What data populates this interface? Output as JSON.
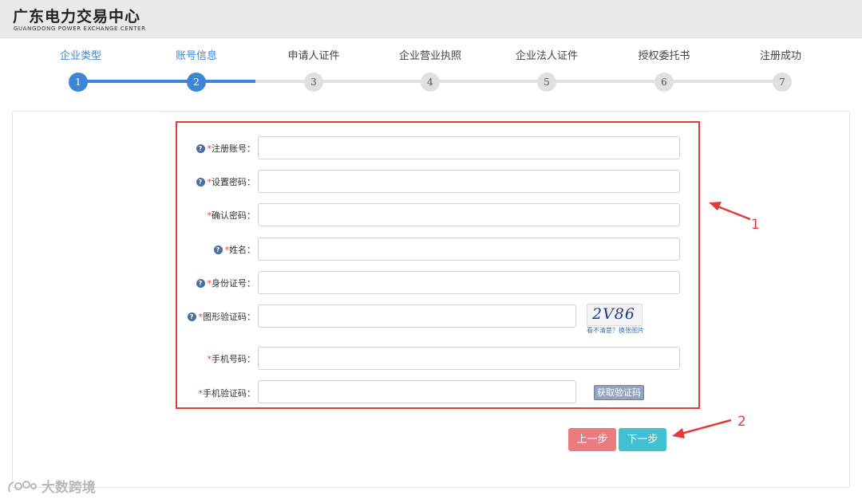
{
  "header": {
    "title": "广东电力交易中心",
    "subtitle": "GUANGDONG POWER EXCHANGE CENTER"
  },
  "steps": [
    {
      "label": "企业类型",
      "number": "1",
      "done": true
    },
    {
      "label": "账号信息",
      "number": "2",
      "done": true
    },
    {
      "label": "申请人证件",
      "number": "3",
      "done": false
    },
    {
      "label": "企业营业执照",
      "number": "4",
      "done": false
    },
    {
      "label": "企业法人证件",
      "number": "5",
      "done": false
    },
    {
      "label": "授权委托书",
      "number": "6",
      "done": false
    },
    {
      "label": "注册成功",
      "number": "7",
      "done": false
    }
  ],
  "form": {
    "fields": [
      {
        "label": "注册账号：",
        "required": "*",
        "has_help": true,
        "value": ""
      },
      {
        "label": "设置密码：",
        "required": "*",
        "has_help": true,
        "value": ""
      },
      {
        "label": "确认密码：",
        "required": "*",
        "has_help": false,
        "value": ""
      },
      {
        "label": "姓名：",
        "required": "*",
        "has_help": true,
        "value": ""
      },
      {
        "label": "身份证号：",
        "required": "*",
        "has_help": true,
        "value": ""
      },
      {
        "label": "图形验证码：",
        "required": "*",
        "has_help": true,
        "value": ""
      },
      {
        "label": "手机号码：",
        "required": "*",
        "has_help": false,
        "value": ""
      },
      {
        "label": "手机验证码：",
        "required": "*",
        "has_help": false,
        "value": ""
      }
    ],
    "help_icon": "?",
    "captcha_text": "2V86",
    "captcha_refresh": "看不清楚？换张图片",
    "sms_button": "获取验证码"
  },
  "buttons": {
    "prev": "上一步",
    "next": "下一步"
  },
  "annotations": {
    "label_1": "1",
    "label_2": "2"
  },
  "watermark": "大数跨境",
  "colors": {
    "accent": "#3d86d6",
    "highlight": "#e53935",
    "prev_button": "#ec7b7f",
    "next_button": "#40c0d0"
  }
}
